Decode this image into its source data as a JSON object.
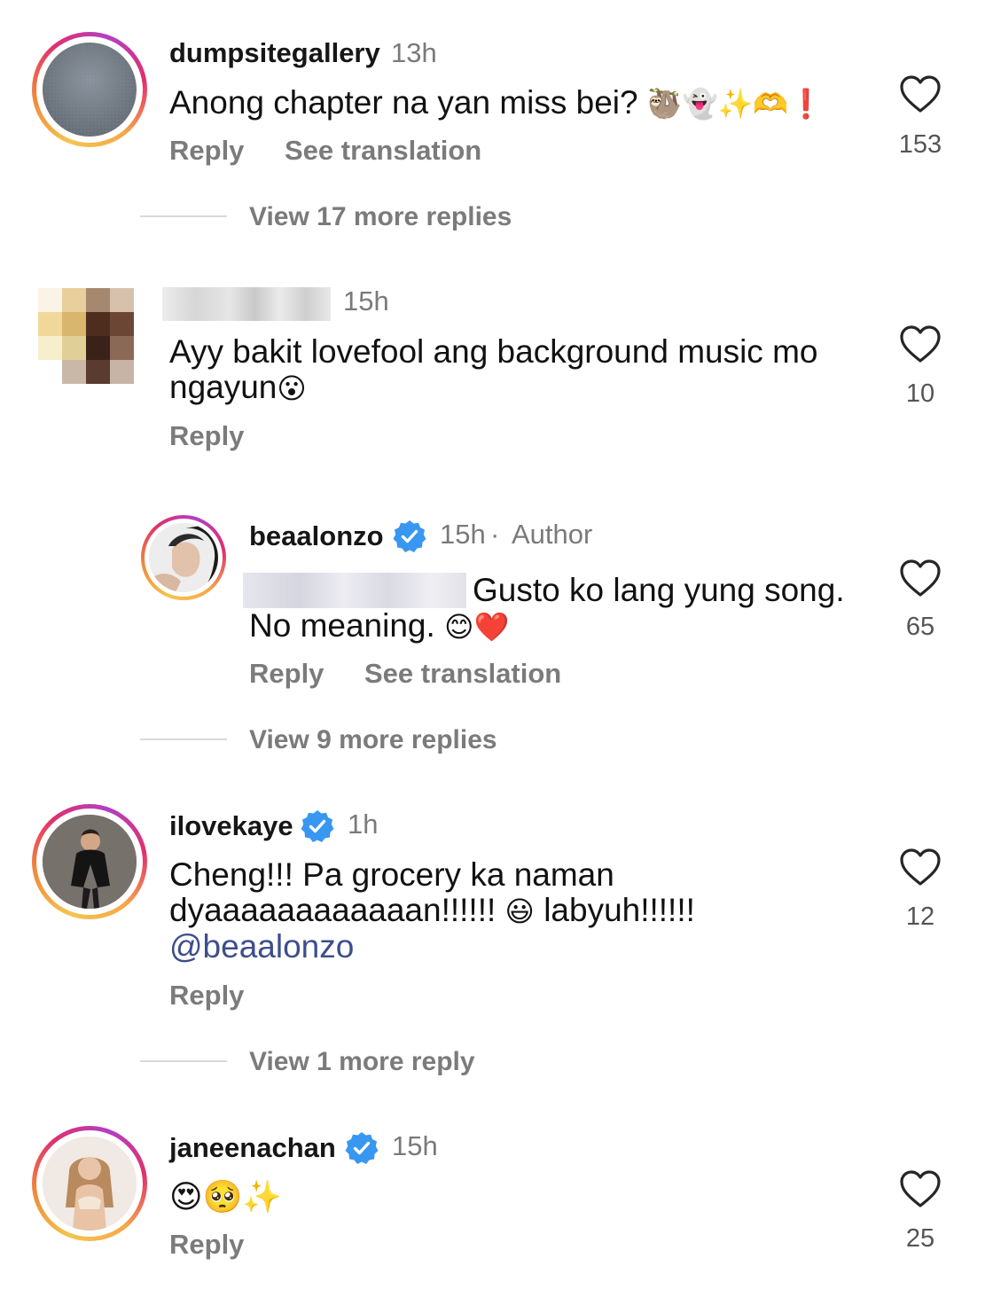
{
  "comments": [
    {
      "username": "dumpsitegallery",
      "time": "13h",
      "text": "Anong chapter na yan miss bei?",
      "emojis": "🦥👻✨🫶❗",
      "reply_label": "Reply",
      "translate_label": "See translation",
      "likes": "153",
      "view_replies": "View 17 more replies"
    },
    {
      "time": "15h",
      "text_line1": "Ayy bakit lovefool ang background music mo",
      "text_line2": "ngayun",
      "emoji": "😮",
      "reply_label": "Reply",
      "likes": "10"
    },
    {
      "username": "beaalonzo",
      "time": "15h",
      "separator": "·",
      "author_label": "Author",
      "text_line1": "Gusto ko lang yung song.",
      "text_line2": "No meaning.",
      "emojis": "😊❤️",
      "reply_label": "Reply",
      "translate_label": "See translation",
      "likes": "65",
      "view_replies": "View 9 more replies"
    },
    {
      "username": "ilovekaye",
      "time": "1h",
      "text_line1": "Cheng!!! Pa grocery ka naman",
      "text_line2a": "dyaaaaaaaaaaaan!!!!!!",
      "emoji": "😃",
      "text_line2b": "labyuh!!!!!!",
      "mention": "@beaalonzo",
      "reply_label": "Reply",
      "likes": "12",
      "view_replies": "View 1 more reply"
    },
    {
      "username": "janeenachan",
      "time": "15h",
      "emojis": "😍🥺✨",
      "reply_label": "Reply",
      "likes": "25"
    }
  ],
  "colors": {
    "verified_badge": "#3897f0",
    "mention": "#3d4e8c",
    "secondary_text": "#7b7b7b"
  },
  "icons": [
    "heart-icon",
    "verified-badge-icon"
  ]
}
